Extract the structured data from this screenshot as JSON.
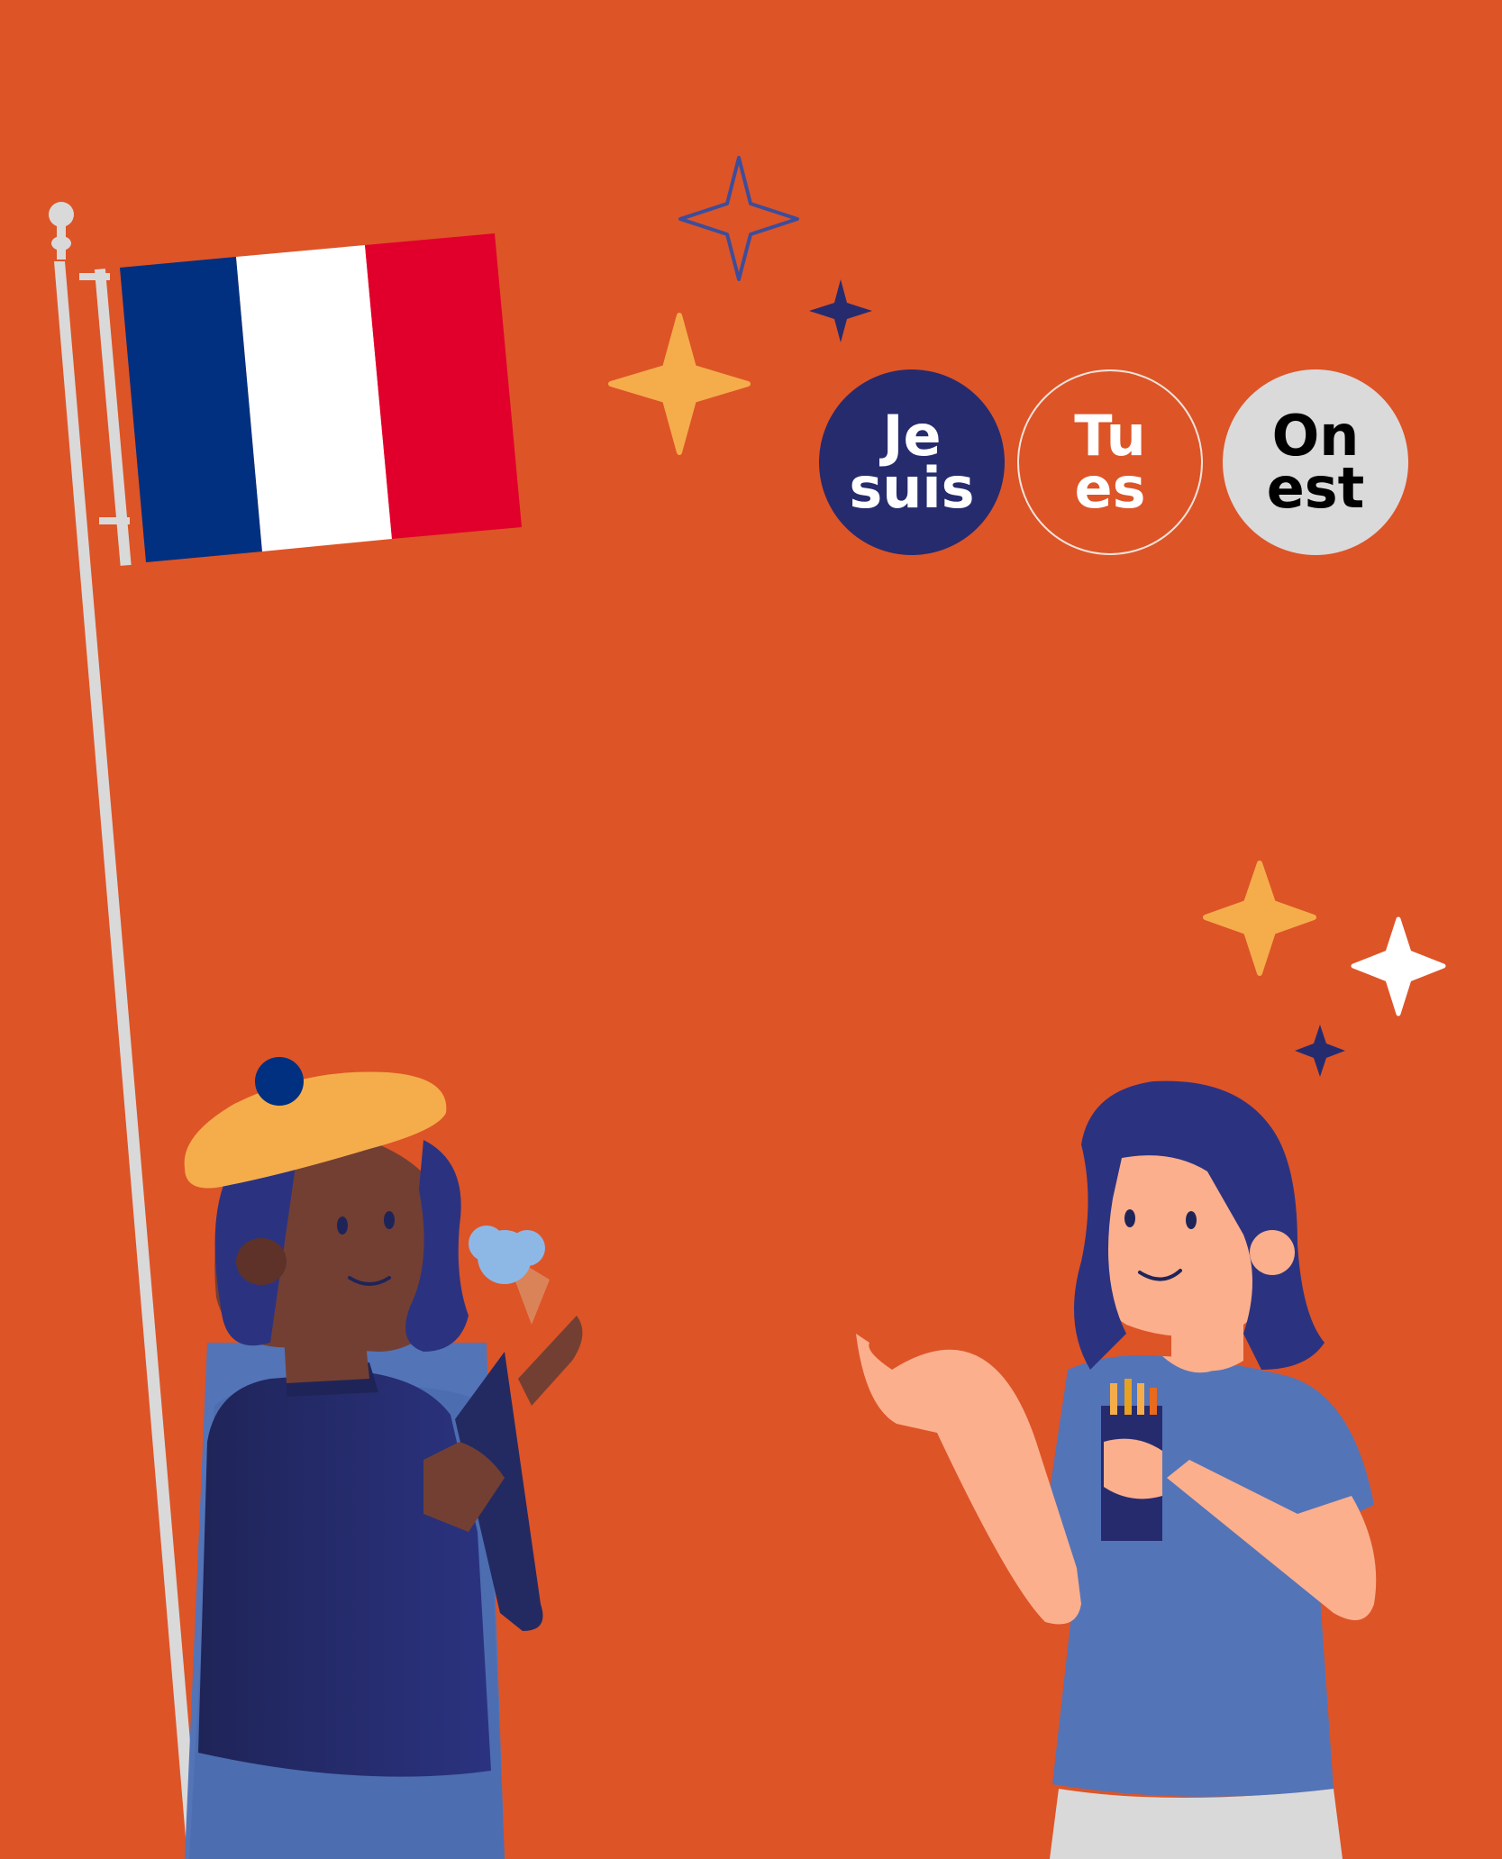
{
  "colors": {
    "background": "#DD5427",
    "navy": "#242D6E",
    "flag_blue": "#00307F",
    "flag_red": "#E1002C",
    "white": "#FFFFFF",
    "gold": "#F5AD4B",
    "light_gray": "#DADADA",
    "shirt_blue": "#5474B8",
    "skin_light": "#FBAF8D",
    "skin_dark": "#733F33",
    "ice_cream": "#8DB8E6"
  },
  "bubbles": [
    {
      "line1": "Je",
      "line2": "suis",
      "fill": "#262B6E",
      "text_color": "#FFFFFF"
    },
    {
      "line1": "Tu",
      "line2": "es",
      "fill": "#DD5427",
      "text_color": "#FFFFFF"
    },
    {
      "line1": "On",
      "line2": "est",
      "fill": "#DADADA",
      "text_color": "#000000"
    }
  ],
  "icons": {
    "flag": "french-flag-icon",
    "sparkles": "sparkle-icon"
  }
}
